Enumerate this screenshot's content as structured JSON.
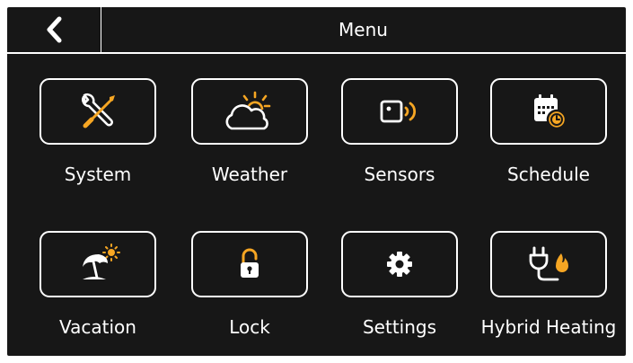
{
  "header": {
    "title": "Menu",
    "back_icon": "chevron-left-icon"
  },
  "colors": {
    "background": "#171717",
    "foreground": "#ffffff",
    "accent": "#f6a623"
  },
  "menu": {
    "items": [
      {
        "label": "System",
        "icon": "wrench-screwdriver-icon"
      },
      {
        "label": "Weather",
        "icon": "sun-cloud-icon"
      },
      {
        "label": "Sensors",
        "icon": "sensor-signal-icon"
      },
      {
        "label": "Schedule",
        "icon": "calendar-clock-icon"
      },
      {
        "label": "Vacation",
        "icon": "beach-umbrella-icon"
      },
      {
        "label": "Lock",
        "icon": "padlock-icon"
      },
      {
        "label": "Settings",
        "icon": "gear-icon"
      },
      {
        "label": "Hybrid Heating",
        "icon": "plug-flame-icon"
      }
    ]
  }
}
